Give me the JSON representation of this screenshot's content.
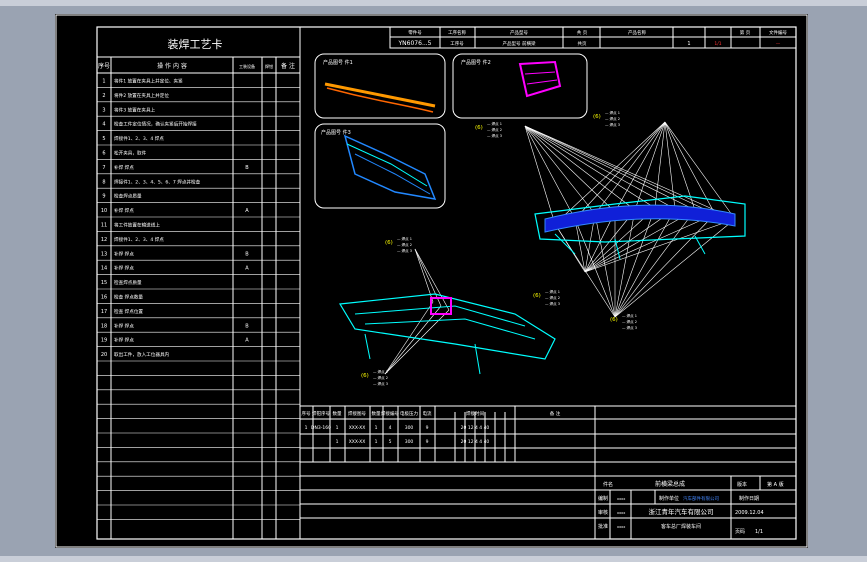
{
  "process_table": {
    "title": "装焊工艺卡",
    "headers": [
      "序号",
      "操 作 内 容",
      "工装设备",
      "焊钳",
      "备 注"
    ],
    "rows": [
      {
        "no": "1",
        "text": "将件1 放置在夹具上并定位、夹紧",
        "eq": "",
        "rm": ""
      },
      {
        "no": "2",
        "text": "将件2 放置在夹具上并定位",
        "eq": "",
        "rm": ""
      },
      {
        "no": "3",
        "text": "将件3 放置在夹具上",
        "eq": "",
        "rm": ""
      },
      {
        "no": "4",
        "text": "检查工件定位情况，确认夹紧后开始焊接",
        "eq": "",
        "rm": ""
      },
      {
        "no": "5",
        "text": "焊接件1、2、3、4 焊点",
        "eq": "",
        "rm": ""
      },
      {
        "no": "6",
        "text": "松开夹具，取件",
        "eq": "",
        "rm": ""
      },
      {
        "no": "7",
        "text": "补焊 焊点",
        "eq": "B",
        "rm": ""
      },
      {
        "no": "8",
        "text": "焊接件1、2、3、4、5、6、7 焊点并检查",
        "eq": "",
        "rm": ""
      },
      {
        "no": "9",
        "text": "检查焊点质量",
        "eq": "",
        "rm": ""
      },
      {
        "no": "10",
        "text": "补焊 焊点",
        "eq": "A",
        "rm": ""
      },
      {
        "no": "11",
        "text": "将工件放置在输送线上",
        "eq": "",
        "rm": ""
      },
      {
        "no": "12",
        "text": "焊接件1、2、3、4 焊点",
        "eq": "",
        "rm": ""
      },
      {
        "no": "13",
        "text": "补焊 焊点",
        "eq": "B",
        "rm": ""
      },
      {
        "no": "14",
        "text": "补焊 焊点",
        "eq": "A",
        "rm": ""
      },
      {
        "no": "15",
        "text": "检查焊点质量",
        "eq": "",
        "rm": ""
      },
      {
        "no": "16",
        "text": "检查 焊点数量",
        "eq": "",
        "rm": ""
      },
      {
        "no": "17",
        "text": "检查 焊点位置",
        "eq": "",
        "rm": ""
      },
      {
        "no": "18",
        "text": "补焊 焊点",
        "eq": "B",
        "rm": ""
      },
      {
        "no": "19",
        "text": "补焊 焊点",
        "eq": "A",
        "rm": ""
      },
      {
        "no": "20",
        "text": "取出工件，放入工位器具内",
        "eq": "",
        "rm": ""
      }
    ]
  },
  "title_strip": {
    "labels": [
      "零件号",
      "工序名称",
      "产品型号",
      "共 页",
      "产品名称",
      "第 页",
      "文件编号"
    ],
    "drawing_number": "YN6076...5",
    "values": [
      "工序号",
      "产品型号 前横梁",
      "共页",
      "1",
      "1/1",
      "—"
    ]
  },
  "part_views": [
    {
      "label": "产品图号 件1"
    },
    {
      "label": "产品图号 件2"
    },
    {
      "label": "产品图号 件3"
    }
  ],
  "callouts": [
    {
      "tag": "(6)",
      "lines": [
        "— 焊点 1",
        "— 焊点 2",
        "— 焊点 3"
      ]
    },
    {
      "tag": "(6)",
      "lines": [
        "— 焊点 1",
        "— 焊点 2",
        "— 焊点 3"
      ]
    },
    {
      "tag": "(6)",
      "lines": [
        "— 焊点 1",
        "— 焊点 2",
        "— 焊点 3"
      ]
    },
    {
      "tag": "(6)",
      "lines": [
        "— 焊点 1",
        "— 焊点 2",
        "— 焊点 3"
      ]
    },
    {
      "tag": "(6)",
      "lines": [
        "— 焊点 1",
        "— 焊点 2",
        "— 焊点 3"
      ]
    },
    {
      "tag": "(6)",
      "lines": [
        "— 焊点 1",
        "— 焊点 2",
        "— 焊点 3"
      ]
    }
  ],
  "parameter_table": {
    "headers": [
      "序号",
      "焊钳序号",
      "数量",
      "焊接图号",
      "数量",
      "焊接编号",
      "电极压力",
      "电流",
      "焊接时间",
      "备 注"
    ],
    "rows": [
      [
        "1",
        "DN3-160",
        "1",
        "XXX-XX",
        "1",
        "4",
        "300",
        "9",
        "20 12 4 4 40",
        ""
      ],
      [
        "",
        "",
        "1",
        "XXX-XX",
        "1",
        "5",
        "300",
        "9",
        "20 12 4 4 40",
        ""
      ]
    ]
  },
  "title_block": {
    "part_name_label": "件名",
    "part_name": "前横梁总成",
    "version_label": "版本",
    "version": "第 A 版",
    "rows": [
      {
        "label": "编制",
        "sign": "xxxx"
      },
      {
        "label": "审核",
        "sign": "xxxx"
      },
      {
        "label": "批准",
        "sign": "xxxx"
      }
    ],
    "maker_label": "制作单位",
    "maker": "汽车部件有限公司",
    "date_label": "制作日期",
    "company": "浙江青年汽车有限公司",
    "date": "2009.12.04",
    "plant": "客车总厂焊装车间",
    "sheet_label": "页码",
    "sheet": "1/1"
  }
}
